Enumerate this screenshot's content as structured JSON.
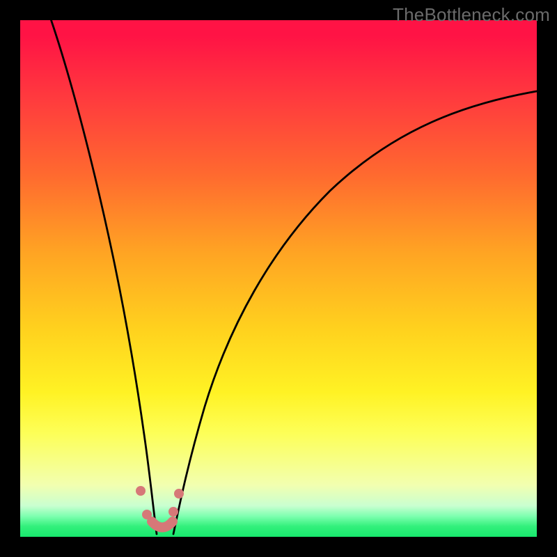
{
  "watermark": "TheBottleneck.com",
  "chart_data": {
    "type": "line",
    "title": "",
    "xlabel": "",
    "ylabel": "",
    "xlim": [
      0,
      100
    ],
    "ylim": [
      0,
      100
    ],
    "yaxis_inverted": false,
    "background_gradient": {
      "direction": "top_to_bottom",
      "stops": [
        {
          "pct": 0,
          "color": "#ff1345"
        },
        {
          "pct": 30,
          "color": "#ff6a2f"
        },
        {
          "pct": 60,
          "color": "#ffd21e"
        },
        {
          "pct": 80,
          "color": "#fdff58"
        },
        {
          "pct": 96,
          "color": "#7effb0"
        },
        {
          "pct": 100,
          "color": "#18e86e"
        }
      ]
    },
    "series": [
      {
        "name": "left_branch",
        "x": [
          6,
          9,
          12,
          15,
          18,
          20,
          22,
          23.5,
          25,
          26
        ],
        "y": [
          100,
          85,
          68,
          53,
          37,
          26,
          16,
          9,
          4,
          1
        ]
      },
      {
        "name": "right_branch",
        "x": [
          30,
          32,
          35,
          40,
          48,
          58,
          70,
          85,
          100
        ],
        "y": [
          1,
          7,
          17,
          32,
          49,
          62,
          73,
          81,
          86
        ]
      }
    ],
    "markers": {
      "name": "bottom_cluster",
      "color": "#d67878",
      "points": [
        {
          "x": 23,
          "y": 9
        },
        {
          "x": 24.5,
          "y": 4
        },
        {
          "x": 29.5,
          "y": 4
        },
        {
          "x": 30.5,
          "y": 8
        }
      ],
      "u_segment": {
        "start": {
          "x": 25.5,
          "y": 2.5
        },
        "mid": {
          "x": 27.5,
          "y": 1
        },
        "end": {
          "x": 29.5,
          "y": 2.5
        }
      }
    }
  }
}
